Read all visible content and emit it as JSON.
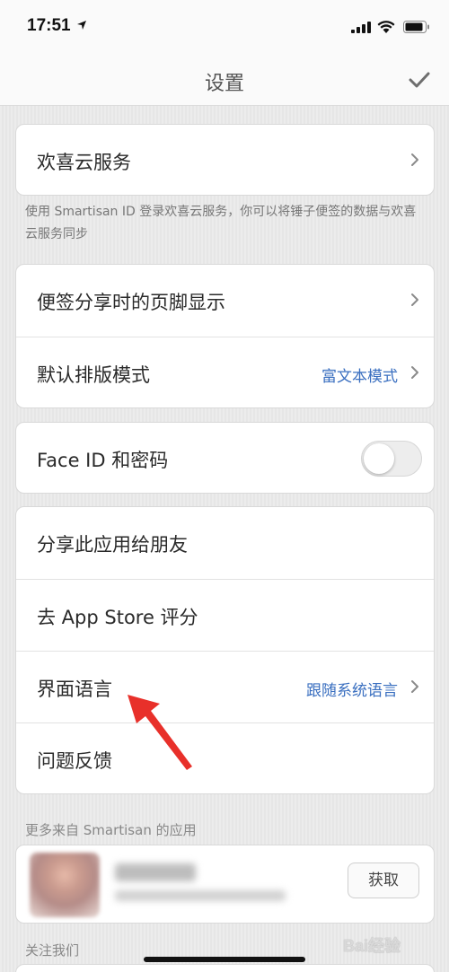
{
  "status": {
    "time": "17:51"
  },
  "nav": {
    "title": "设置",
    "confirm_icon": "checkmark-icon"
  },
  "cloud": {
    "label": "欢喜云服务",
    "hint": "使用 Smartisan ID 登录欢喜云服务，你可以将锤子便签的数据与欢喜云服务同步"
  },
  "share_footer": {
    "label": "便签分享时的页脚显示"
  },
  "layout_mode": {
    "label": "默认排版模式",
    "value": "富文本模式"
  },
  "face_id": {
    "label": "Face ID 和密码",
    "enabled": false
  },
  "misc": {
    "share_app": "分享此应用给朋友",
    "rate": "去 App Store 评分",
    "language_label": "界面语言",
    "language_value": "跟随系统语言",
    "feedback": "问题反馈"
  },
  "more_apps": {
    "header": "更多来自 Smartisan 的应用",
    "get_label": "获取"
  },
  "follow": {
    "header": "关注我们"
  },
  "watermark": "Bai经验",
  "colors": {
    "accent": "#3a6fc0",
    "annotation_arrow": "#e8302a"
  }
}
